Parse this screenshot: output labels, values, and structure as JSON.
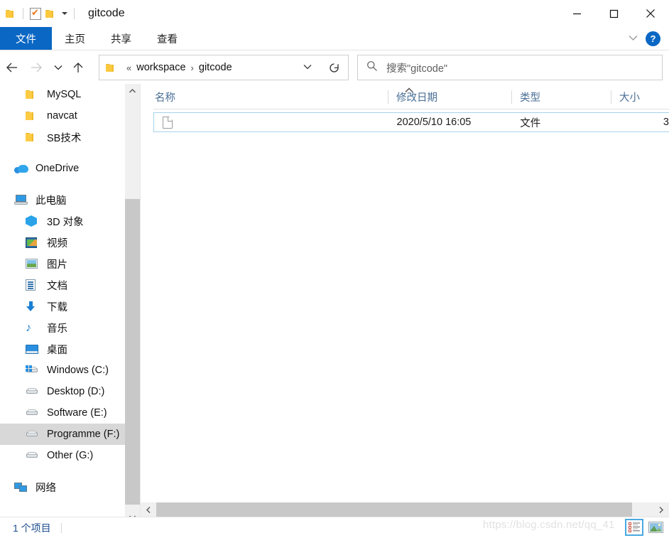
{
  "window": {
    "title": "gitcode",
    "quick_access": [
      "folder-icon",
      "properties-icon",
      "new-folder-icon",
      "qat-dropdown-icon"
    ],
    "minimize_label": "—",
    "maximize_label": "□",
    "close_label": "✕"
  },
  "ribbon": {
    "tabs": [
      {
        "label": "文件",
        "active": true
      },
      {
        "label": "主页",
        "active": false
      },
      {
        "label": "共享",
        "active": false
      },
      {
        "label": "查看",
        "active": false
      }
    ],
    "help_label": "?",
    "expand_icon": "chevron-down-icon"
  },
  "navbar": {
    "back_icon": "arrow-left-icon",
    "forward_icon": "arrow-right-icon",
    "recent_icon": "chevron-down-icon",
    "up_icon": "arrow-up-icon",
    "refresh_icon": "refresh-icon",
    "address": {
      "folder_icon": "folder-icon",
      "overflow": "«",
      "crumbs": [
        "workspace",
        "gitcode"
      ],
      "separator": "›",
      "dropdown_icon": "chevron-down-icon"
    },
    "search": {
      "icon": "search-icon",
      "placeholder": "搜索\"gitcode\""
    }
  },
  "sidebar": {
    "items": [
      {
        "label": "MySQL",
        "icon": "folder-icon",
        "indent": 1,
        "selected": false
      },
      {
        "label": "navcat",
        "icon": "folder-icon",
        "indent": 1,
        "selected": false
      },
      {
        "label": "SB技术",
        "icon": "folder-icon",
        "indent": 1,
        "selected": false
      },
      {
        "label": "OneDrive",
        "icon": "onedrive-icon",
        "indent": 0,
        "selected": false
      },
      {
        "label": "此电脑",
        "icon": "this-pc-icon",
        "indent": 0,
        "selected": false
      },
      {
        "label": "3D 对象",
        "icon": "3d-objects-icon",
        "indent": 1,
        "selected": false
      },
      {
        "label": "视频",
        "icon": "videos-icon",
        "indent": 1,
        "selected": false
      },
      {
        "label": "图片",
        "icon": "pictures-icon",
        "indent": 1,
        "selected": false
      },
      {
        "label": "文档",
        "icon": "documents-icon",
        "indent": 1,
        "selected": false
      },
      {
        "label": "下载",
        "icon": "downloads-icon",
        "indent": 1,
        "selected": false
      },
      {
        "label": "音乐",
        "icon": "music-icon",
        "indent": 1,
        "selected": false
      },
      {
        "label": "桌面",
        "icon": "desktop-icon",
        "indent": 1,
        "selected": false
      },
      {
        "label": "Windows (C:)",
        "icon": "windows-drive-icon",
        "indent": 1,
        "selected": false
      },
      {
        "label": "Desktop (D:)",
        "icon": "drive-icon",
        "indent": 1,
        "selected": false
      },
      {
        "label": "Software (E:)",
        "icon": "drive-icon",
        "indent": 1,
        "selected": false
      },
      {
        "label": "Programme (F:)",
        "icon": "drive-icon",
        "indent": 1,
        "selected": true
      },
      {
        "label": "Other (G:)",
        "icon": "drive-icon",
        "indent": 1,
        "selected": false
      },
      {
        "label": "网络",
        "icon": "network-icon",
        "indent": 0,
        "selected": false
      }
    ],
    "scroll_up_icon": "chevron-up-icon",
    "scroll_down_icon": "chevron-down-icon"
  },
  "filelist": {
    "columns": [
      {
        "key": "name",
        "label": "名称",
        "sorted": "asc"
      },
      {
        "key": "date",
        "label": "修改日期"
      },
      {
        "key": "type",
        "label": "类型"
      },
      {
        "key": "size",
        "label": "大小"
      }
    ],
    "sort_indicator": "˄",
    "rows": [
      {
        "icon": "file-icon",
        "name": "",
        "date": "2020/5/10 16:05",
        "type": "文件",
        "size": "3"
      }
    ],
    "hscroll_left_icon": "chevron-left-icon",
    "hscroll_right_icon": "chevron-right-icon"
  },
  "statusbar": {
    "item_count": "1 个项目",
    "views": [
      {
        "name": "details-view",
        "active": true
      },
      {
        "name": "large-icons-view",
        "active": false
      }
    ]
  },
  "watermark": {
    "text": "https://blog.csdn.net/qq_41"
  },
  "colors": {
    "accent": "#0a67c4",
    "header_text": "#4a6f96",
    "selection": "#d8d8d8",
    "row_border": "#a5d4ef",
    "scrollbar_thumb": "#c8c8c8"
  }
}
